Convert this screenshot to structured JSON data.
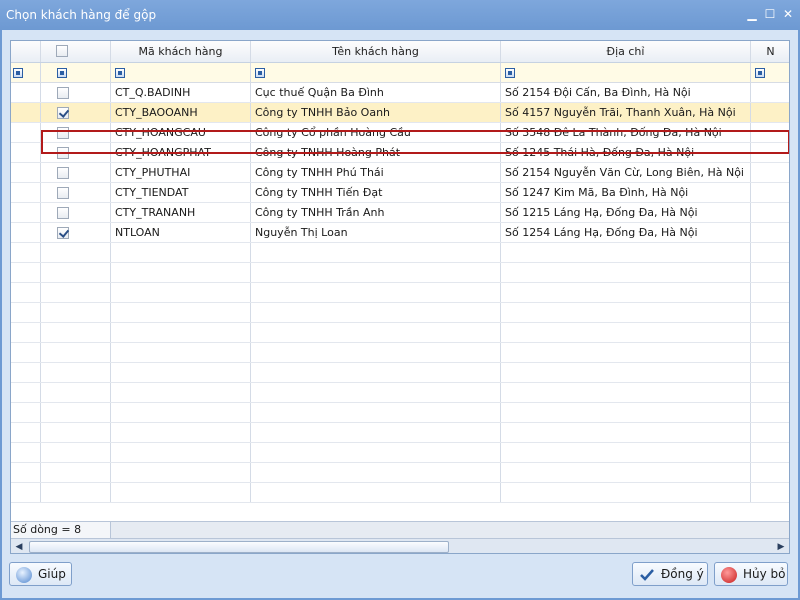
{
  "window": {
    "title": "Chọn khách hàng để gộp"
  },
  "grid": {
    "columns": [
      "Mã khách hàng",
      "Tên khách hàng",
      "Địa chỉ",
      "N"
    ],
    "rows": [
      {
        "checked": false,
        "ma": "CT_Q.BADINH",
        "ten": "Cục thuế Quận Ba Đình",
        "diachi": "Số 2154 Đội Cấn, Ba Đình, Hà Nội",
        "selected": false
      },
      {
        "checked": true,
        "ma": "CTY_BAOOANH",
        "ten": "Công ty TNHH Bảo Oanh",
        "diachi": "Số 4157 Nguyễn Trãi, Thanh Xuân, Hà Nội",
        "selected": true
      },
      {
        "checked": false,
        "ma": "CTY_HOANGCAU",
        "ten": "Công ty Cổ phần Hoàng Cầu",
        "diachi": "Số 3548 Đê La Thành, Đống Đa, Hà Nội",
        "selected": false
      },
      {
        "checked": false,
        "ma": "CTY_HOANGPHAT",
        "ten": "Công ty TNHH Hoàng Phát",
        "diachi": "Số 1245 Thái Hà, Đống Đa, Hà Nội",
        "selected": false
      },
      {
        "checked": false,
        "ma": "CTY_PHUTHAI",
        "ten": "Công ty TNHH Phú Thái",
        "diachi": "Số 2154 Nguyễn Văn Cừ, Long Biên, Hà Nội",
        "selected": false
      },
      {
        "checked": false,
        "ma": "CTY_TIENDAT",
        "ten": "Công ty TNHH Tiến Đạt",
        "diachi": "Số 1247 Kim Mã, Ba Đình, Hà Nội",
        "selected": false
      },
      {
        "checked": false,
        "ma": "CTY_TRANANH",
        "ten": "Công ty TNHH Trần Anh",
        "diachi": "Số 1215 Láng Hạ, Đống Đa, Hà Nội",
        "selected": false
      },
      {
        "checked": true,
        "ma": "NTLOAN",
        "ten": "Nguyễn Thị Loan",
        "diachi": "Số 1254 Láng Hạ, Đống Đa, Hà Nội",
        "selected": false
      }
    ],
    "footer": "Số dòng = 8"
  },
  "buttons": {
    "help": "Giúp",
    "ok": "Đồng ý",
    "cancel": "Hủy bỏ"
  },
  "colors": {
    "selected_row": "#fdf1c6",
    "selection_border": "#b21a1a",
    "title_bar": "#6e9ad3"
  }
}
